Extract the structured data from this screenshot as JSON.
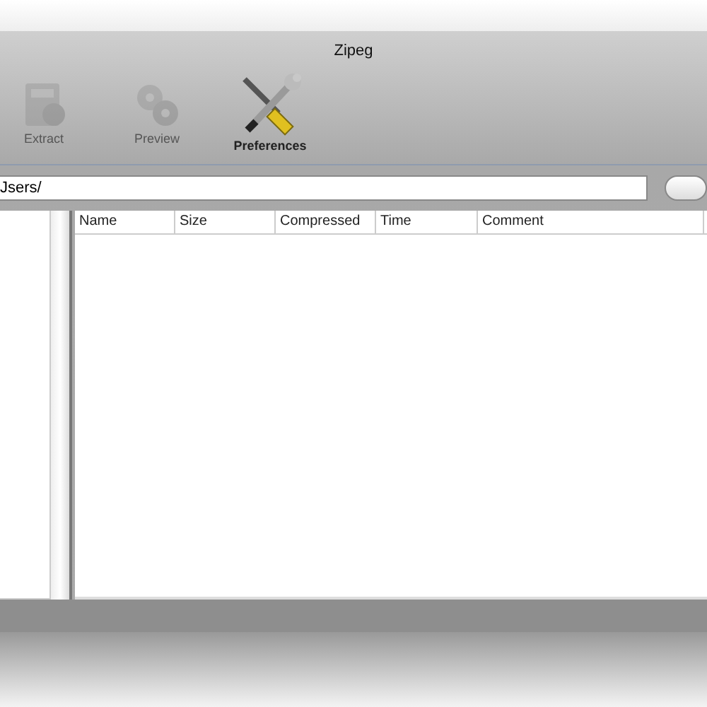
{
  "window": {
    "title": "Zipeg"
  },
  "toolbar": [
    {
      "label": "Extract",
      "kind": "extract",
      "disabled": true
    },
    {
      "label": "Preview",
      "kind": "preview",
      "disabled": true
    },
    {
      "label": "Preferences",
      "kind": "preferences",
      "disabled": false
    }
  ],
  "path_field": {
    "value": "Jsers/"
  },
  "table": {
    "columns": [
      "Name",
      "Size",
      "Compressed",
      "Time",
      "Comment"
    ]
  }
}
